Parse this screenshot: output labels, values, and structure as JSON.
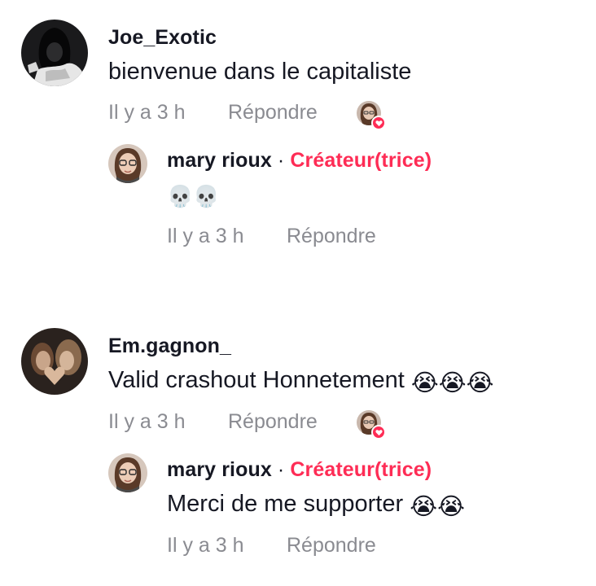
{
  "comments": [
    {
      "username": "Joe_Exotic",
      "text": "bienvenue dans le capitaliste",
      "time": "Il y a 3 h",
      "reply_label": "Répondre",
      "avatar_icon": "hooded-figure-avatar",
      "reply": {
        "username": "mary rioux",
        "separator": "·",
        "badge": "Créateur(trice)",
        "emojis": [
          "💀",
          "💀"
        ],
        "time": "Il y a 3 h",
        "reply_label": "Répondre"
      }
    },
    {
      "username": "Em.gagnon_",
      "text": "Valid crashout Honnetement",
      "emojis": [
        "😭",
        "😭",
        "😭"
      ],
      "time": "Il y a 3 h",
      "reply_label": "Répondre",
      "avatar_icon": "two-people-heart-avatar",
      "reply": {
        "username": "mary rioux",
        "separator": "·",
        "badge": "Créateur(trice)",
        "text": "Merci de me supporter",
        "emojis": [
          "😭",
          "😭"
        ],
        "time": "Il y a 3 h",
        "reply_label": "Répondre"
      }
    }
  ],
  "colors": {
    "creator_badge": "#fe2c55",
    "primary_text": "#161823",
    "secondary_text": "#8a8b91",
    "heart": "#fe2c55"
  }
}
